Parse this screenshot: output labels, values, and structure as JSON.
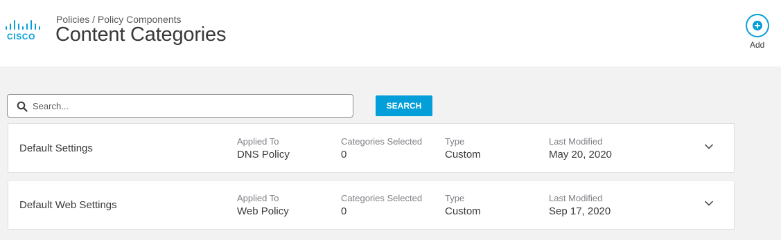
{
  "brand": {
    "logo_text": "CISCO",
    "accent_color": "#049fd9"
  },
  "header": {
    "breadcrumb": "Policies / Policy Components",
    "title": "Content Categories",
    "add_label": "Add",
    "add_icon": "plus-circle-icon"
  },
  "search": {
    "placeholder": "Search...",
    "value": "",
    "button_label": "SEARCH",
    "icon": "search-icon"
  },
  "columns": {
    "applied_to": "Applied To",
    "categories_selected": "Categories Selected",
    "type": "Type",
    "last_modified": "Last Modified"
  },
  "rows": [
    {
      "name": "Default Settings",
      "applied_to": "DNS Policy",
      "categories_selected": "0",
      "type": "Custom",
      "last_modified": "May 20, 2020"
    },
    {
      "name": "Default Web Settings",
      "applied_to": "Web Policy",
      "categories_selected": "0",
      "type": "Custom",
      "last_modified": "Sep 17, 2020"
    }
  ]
}
